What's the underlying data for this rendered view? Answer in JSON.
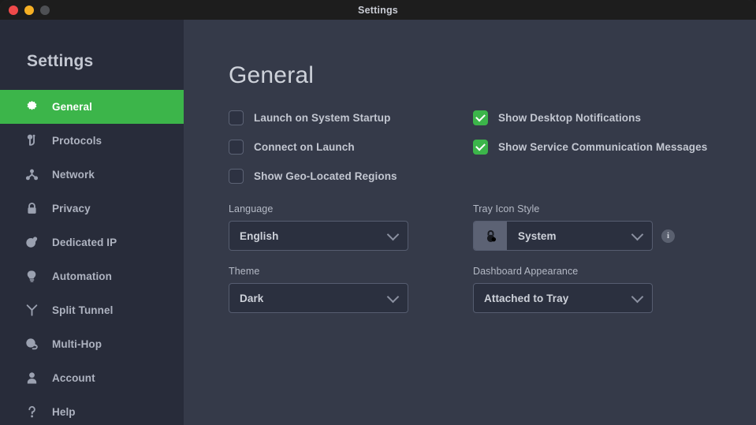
{
  "window": {
    "title": "Settings",
    "traffic_lights": [
      "close",
      "minimize",
      "zoom"
    ]
  },
  "sidebar": {
    "title": "Settings",
    "items": [
      {
        "label": "General",
        "icon": "gear-icon",
        "active": true
      },
      {
        "label": "Protocols",
        "icon": "protocols-icon",
        "active": false
      },
      {
        "label": "Network",
        "icon": "network-icon",
        "active": false
      },
      {
        "label": "Privacy",
        "icon": "lock-icon",
        "active": false
      },
      {
        "label": "Dedicated IP",
        "icon": "globe-pin-icon",
        "active": false
      },
      {
        "label": "Automation",
        "icon": "lightbulb-icon",
        "active": false
      },
      {
        "label": "Split Tunnel",
        "icon": "split-tunnel-icon",
        "active": false
      },
      {
        "label": "Multi-Hop",
        "icon": "multi-hop-icon",
        "active": false
      },
      {
        "label": "Account",
        "icon": "person-icon",
        "active": false
      },
      {
        "label": "Help",
        "icon": "question-icon",
        "active": false
      }
    ]
  },
  "main": {
    "page_title": "General",
    "checkboxes_left": [
      {
        "label": "Launch on System Startup",
        "checked": false
      },
      {
        "label": "Connect on Launch",
        "checked": false
      },
      {
        "label": "Show Geo-Located Regions",
        "checked": false
      }
    ],
    "checkboxes_right": [
      {
        "label": "Show Desktop Notifications",
        "checked": true
      },
      {
        "label": "Show Service Communication Messages",
        "checked": true
      }
    ],
    "fields": {
      "language": {
        "label": "Language",
        "value": "English"
      },
      "theme": {
        "label": "Theme",
        "value": "Dark"
      },
      "tray_icon": {
        "label": "Tray Icon Style",
        "value": "System",
        "prefix_icon": "lock-icon",
        "info": "i"
      },
      "dashboard": {
        "label": "Dashboard Appearance",
        "value": "Attached to Tray"
      }
    }
  },
  "colors": {
    "accent_green": "#3cb54a",
    "sidebar_bg": "#282c3a",
    "main_bg": "#353a49",
    "titlebar_bg": "#1d1d1d",
    "field_bg": "#2b303f",
    "close_light": "#f04a4a",
    "min_light": "#f6b024",
    "zoom_light": "#4e5054"
  }
}
